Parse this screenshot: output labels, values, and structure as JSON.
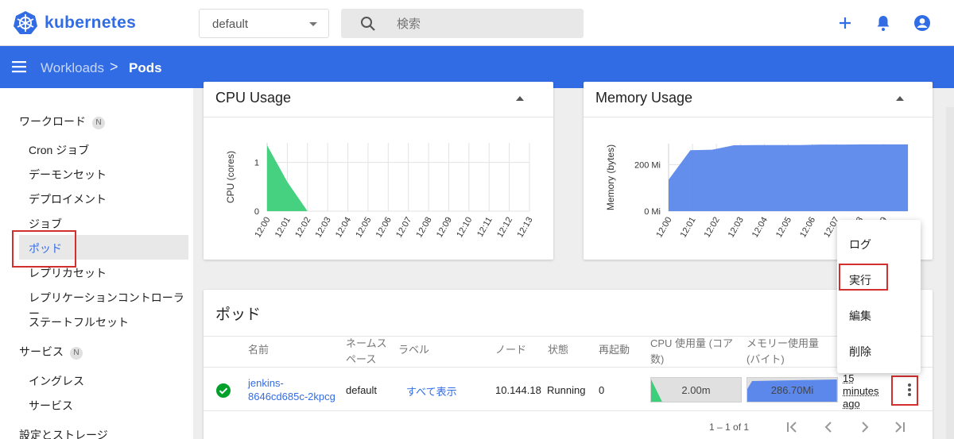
{
  "app": {
    "brand": "kubernetes"
  },
  "toolbar": {
    "namespace": "default",
    "search_placeholder": "検索",
    "icons": [
      "plus-icon",
      "bell-icon",
      "account-icon"
    ]
  },
  "breadcrumb": {
    "parent": "Workloads",
    "separator": ">",
    "current": "Pods"
  },
  "colors": {
    "accent": "#326ce5",
    "highlight": "#d32f2f",
    "ok": "#00a02a",
    "cpu": "#3ccf7a",
    "memory": "#5b88ea"
  },
  "sidebar": {
    "workloads": {
      "label": "ワークロード",
      "badge": "N"
    },
    "items": [
      "Cron ジョブ",
      "デーモンセット",
      "デプロイメント",
      "ジョブ",
      "ポッド",
      "レプリカセット",
      "レプリケーションコントローラー",
      "ステートフルセット"
    ],
    "services": {
      "label": "サービス",
      "badge": "N"
    },
    "service_items": [
      "イングレス",
      "サービス"
    ],
    "config": {
      "label": "設定とストレージ"
    }
  },
  "cpu_card": {
    "title": "CPU Usage"
  },
  "memory_card": {
    "title": "Memory Usage"
  },
  "chart_data": [
    {
      "type": "area",
      "title": "CPU Usage",
      "ylabel": "CPU (cores)",
      "x": [
        "12:00",
        "12:01",
        "12:02",
        "12:03",
        "12:04",
        "12:05",
        "12:06",
        "12:07",
        "12:08",
        "12:09",
        "12:10",
        "12:11",
        "12:12",
        "12:13"
      ],
      "yticks": [
        "0",
        "1"
      ],
      "ylim": [
        0,
        1.4
      ],
      "series": [
        {
          "values": [
            1.35,
            0.6,
            0,
            0,
            0,
            0,
            0,
            0,
            0,
            0,
            0,
            0,
            0,
            0
          ]
        }
      ],
      "grid": true
    },
    {
      "type": "area",
      "title": "Memory Usage",
      "ylabel": "Memory (bytes)",
      "x": [
        "12:00",
        "12:01",
        "12:02",
        "12:03",
        "12:04",
        "12:05",
        "12:06",
        "12:07",
        "12:08",
        "12:09"
      ],
      "yticks": [
        "0 Mi",
        "200 Mi"
      ],
      "ylim": [
        0,
        290
      ],
      "series": [
        {
          "values": [
            135,
            262,
            264,
            283,
            284,
            284,
            284,
            286,
            286,
            287,
            287,
            287
          ]
        }
      ],
      "grid": true
    }
  ],
  "pods_table": {
    "title": "ポッド",
    "columns": [
      "名前",
      "ネームスペース",
      "ラベル",
      "ノード",
      "状態",
      "再起動",
      "CPU 使用量 (コア数)",
      "メモリー使用量 (バイト)"
    ],
    "rows": [
      {
        "name": "jenkins-8646cd685c-2kpcg",
        "namespace": "default",
        "labels": "すべて表示",
        "node": "10.144.18",
        "status": "Running",
        "restarts": "0",
        "cpu": "2.00m",
        "cpu_fraction": 0.1,
        "memory": "286.70Mi",
        "memory_fraction": 0.98,
        "age": "15 minutes ago"
      }
    ],
    "pagination": "1 – 1 of 1"
  },
  "context_menu": {
    "items": [
      "ログ",
      "実行",
      "編集",
      "削除"
    ]
  }
}
